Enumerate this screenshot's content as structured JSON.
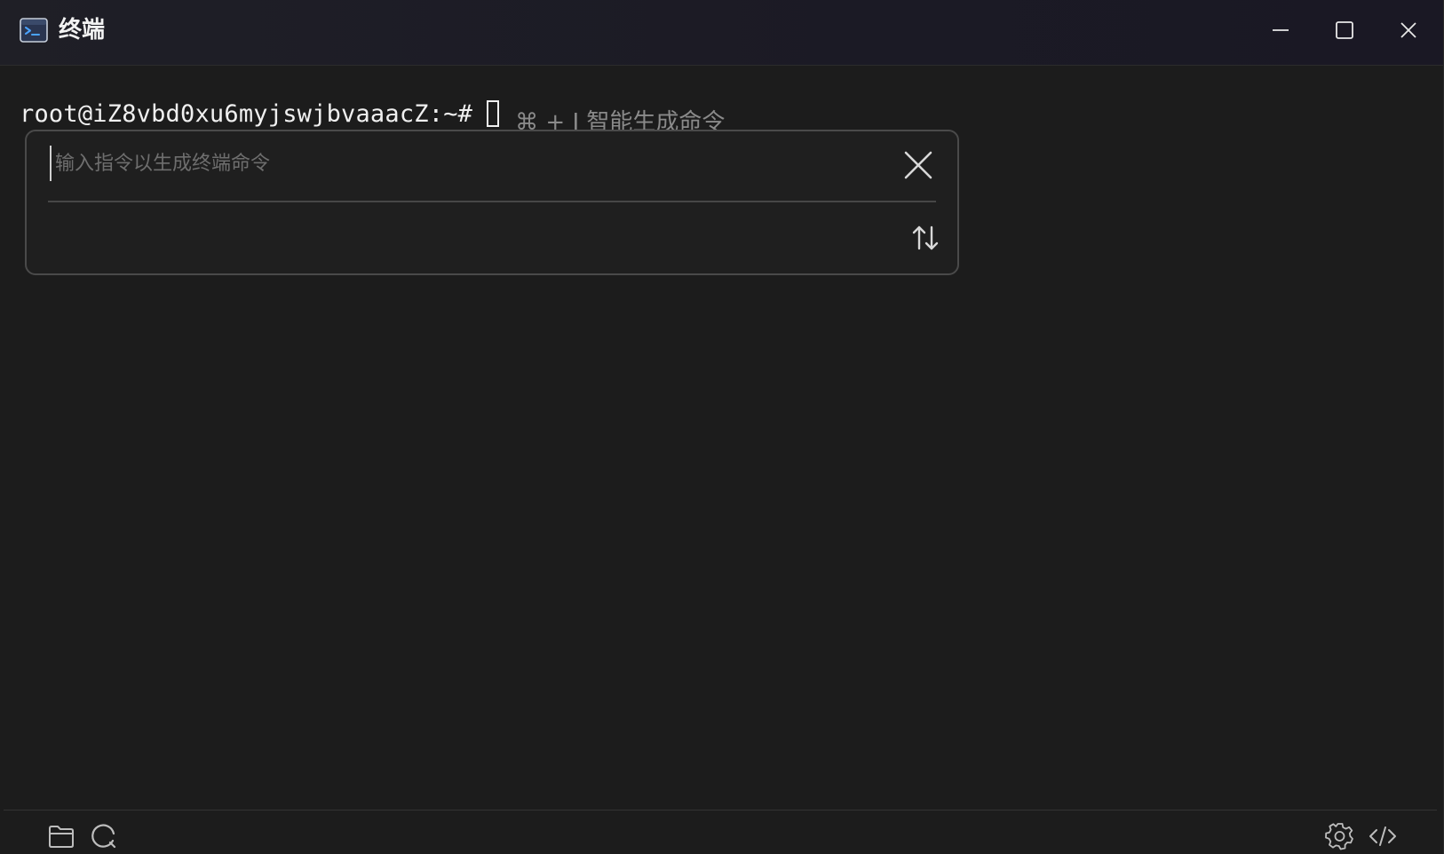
{
  "window": {
    "title": "终端",
    "controls": {
      "minimize": "minimize",
      "maximize": "maximize",
      "close": "close"
    }
  },
  "terminal": {
    "prompt": "root@iZ8vbd0xu6myjswjbvaaacZ:~#",
    "hint": "⌘ + I 智能生成命令"
  },
  "ai_panel": {
    "placeholder": "输入指令以生成终端命令",
    "value": ""
  },
  "icons": {
    "app": "terminal-app-icon",
    "close": "close-icon",
    "swap": "swap-vertical-icon",
    "folder": "folder-icon",
    "refresh": "refresh-icon",
    "settings": "gear-icon",
    "code": "code-icon"
  },
  "colors": {
    "background": "#1c1c1c",
    "titlebar": "#1f1f26",
    "text": "#f0f0f0",
    "muted": "#8a8a8a",
    "accent": "#4aa3ff"
  }
}
